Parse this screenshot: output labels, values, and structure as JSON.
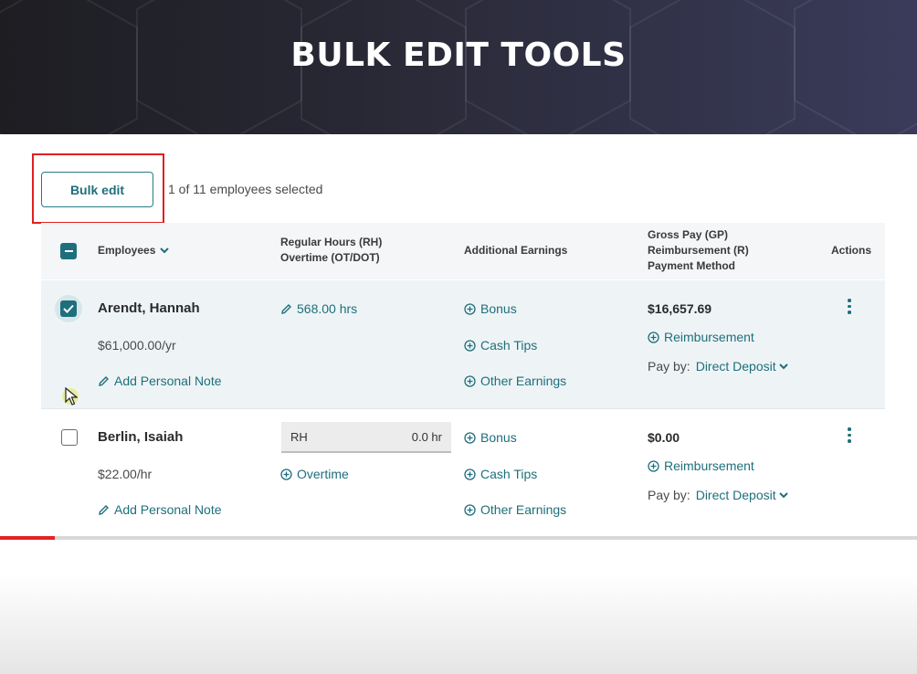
{
  "banner": {
    "title": "BULK EDIT TOOLS"
  },
  "toolbar": {
    "bulk_edit_label": "Bulk edit",
    "selection_text": "1 of 11 employees selected"
  },
  "table": {
    "headers": {
      "employees": "Employees",
      "hours_line1": "Regular Hours (RH)",
      "hours_line2": "Overtime (OT/DOT)",
      "additional_earnings": "Additional Earnings",
      "pay_line1": "Gross Pay (GP)",
      "pay_line2": "Reimbursement (R)",
      "pay_line3": "Payment Method",
      "actions": "Actions"
    },
    "rows": [
      {
        "name": "Arendt, Hannah",
        "checked": true,
        "rate": "$61,000.00/yr",
        "note_label": "Add Personal Note",
        "hours": "568.00 hrs",
        "earnings": [
          "Bonus",
          "Cash Tips",
          "Other Earnings"
        ],
        "gross_pay": "$16,657.69",
        "reimbursement_label": "Reimbursement",
        "pay_by_label": "Pay by:",
        "pay_method": "Direct Deposit"
      },
      {
        "name": "Berlin, Isaiah",
        "checked": false,
        "rate": "$22.00/hr",
        "note_label": "Add Personal Note",
        "rh_label": "RH",
        "rh_value": "0.0 hr",
        "overtime_label": "Overtime",
        "earnings": [
          "Bonus",
          "Cash Tips",
          "Other Earnings"
        ],
        "gross_pay": "$0.00",
        "reimbursement_label": "Reimbursement",
        "pay_by_label": "Pay by:",
        "pay_method": "Direct Deposit"
      }
    ]
  },
  "video": {
    "progress": 0.06
  },
  "colors": {
    "accent": "#1e6f7b",
    "highlight": "#e02020",
    "banner": "#2a2a38"
  },
  "icons": [
    "chevron-down-icon",
    "pencil-icon",
    "plus-circle-icon",
    "kebab-menu-icon",
    "checkbox-icon",
    "cursor-icon"
  ]
}
